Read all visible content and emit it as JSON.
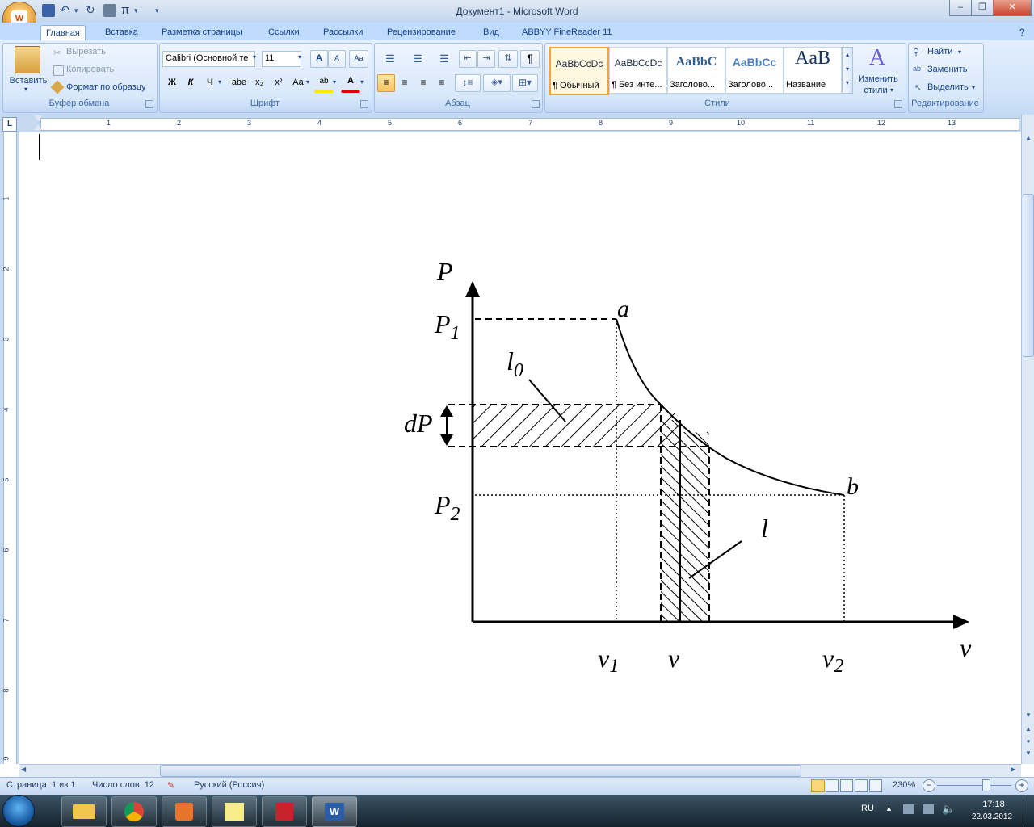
{
  "window": {
    "title": "Документ1 - Microsoft Word",
    "controls": [
      "–",
      "❐",
      "✕"
    ]
  },
  "quick_access": {
    "save_icon": "save-icon",
    "undo_icon": "undo-icon",
    "redo_icon": "redo-icon",
    "print_icon": "print-preview-icon",
    "equation_icon": "π"
  },
  "tabs": [
    {
      "label": "Главная",
      "active": true
    },
    {
      "label": "Вставка"
    },
    {
      "label": "Разметка страницы"
    },
    {
      "label": "Ссылки"
    },
    {
      "label": "Рассылки"
    },
    {
      "label": "Рецензирование"
    },
    {
      "label": "Вид"
    },
    {
      "label": "ABBYY FineReader 11"
    }
  ],
  "clipboard": {
    "paste": "Вставить",
    "cut": "Вырезать",
    "copy": "Копировать",
    "format_painter": "Формат по образцу",
    "group_label": "Буфер обмена"
  },
  "font": {
    "family": "Calibri (Основной те",
    "size": "11",
    "grow": "A",
    "shrink": "A",
    "clear": "Aa",
    "bold": "Ж",
    "italic": "К",
    "underline": "Ч",
    "strike": "abe",
    "subscript": "x₂",
    "superscript": "x²",
    "case": "Aa",
    "highlight": "ab",
    "color": "A",
    "group_label": "Шрифт"
  },
  "paragraph": {
    "group_label": "Абзац",
    "pilcrow": "¶"
  },
  "styles": {
    "group_label": "Стили",
    "cards": [
      {
        "sample": "AaBbCcDc",
        "name": "¶ Обычный",
        "selected": true
      },
      {
        "sample": "AaBbCcDc",
        "name": "¶ Без инте..."
      },
      {
        "sample": "AaBbC",
        "name": "Заголово..."
      },
      {
        "sample": "AaBbCc",
        "name": "Заголово..."
      },
      {
        "sample": "AaB",
        "name": "Название"
      }
    ],
    "change_styles_1": "Изменить",
    "change_styles_2": "стили"
  },
  "editing": {
    "group_label": "Редактирование",
    "find": "Найти",
    "replace": "Заменить",
    "select": "Выделить"
  },
  "ruler": {
    "h_numbers": [
      "1",
      "2",
      "3",
      "4",
      "5",
      "6",
      "7",
      "8",
      "9",
      "10",
      "11",
      "12",
      "13"
    ],
    "v_numbers": [
      "1",
      "2",
      "3",
      "4",
      "5",
      "6",
      "7",
      "8",
      "9"
    ]
  },
  "figure": {
    "labels": {
      "P": "P",
      "P1_main": "P",
      "P1_sub": "1",
      "P2_main": "P",
      "P2_sub": "2",
      "dP": "dP",
      "a": "a",
      "b": "b",
      "l0_main": "l",
      "l0_sub": "0",
      "l": "l",
      "v": "v",
      "v1_main": "v",
      "v1_sub": "1",
      "v_mid": "v",
      "v2_main": "v",
      "v2_sub": "2"
    }
  },
  "status": {
    "page": "Страница: 1 из 1",
    "words": "Число слов: 12",
    "language": "Русский (Россия)",
    "zoom": "230%"
  },
  "taskbar": {
    "lang": "RU",
    "time": "17:18",
    "date": "22.03.2012"
  }
}
